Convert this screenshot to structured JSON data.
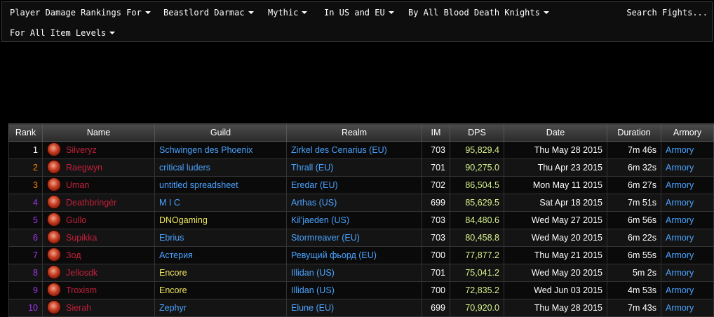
{
  "filters": {
    "rankings": "Player Damage Rankings For",
    "boss": "Beastlord Darmac",
    "difficulty": "Mythic",
    "region": "In US and EU",
    "class": "By All Blood Death Knights",
    "search": "Search Fights...",
    "item_levels": "For All Item Levels"
  },
  "table": {
    "headers": [
      "Rank",
      "Name",
      "Guild",
      "Realm",
      "IM",
      "DPS",
      "Date",
      "Duration",
      "Armory"
    ],
    "rows": [
      {
        "rank": "1",
        "rank_color": "#ffffff",
        "name": "Silveryz",
        "guild": "Schwingen des Phoenix",
        "guild_color": "#4aa3ff",
        "realm": "Zirkel des Cenarius (EU)",
        "im": "703",
        "dps": "95,829.4",
        "date": "Thu May 28 2015",
        "duration": "7m 46s",
        "armory": "Armory"
      },
      {
        "rank": "2",
        "rank_color": "#ff8000",
        "name": "Raegwyn",
        "guild": "critical luders",
        "guild_color": "#4aa3ff",
        "realm": "Thrall (EU)",
        "im": "701",
        "dps": "90,275.0",
        "date": "Thu Apr 23 2015",
        "duration": "6m 32s",
        "armory": "Armory"
      },
      {
        "rank": "3",
        "rank_color": "#ff8000",
        "name": "Uman",
        "guild": "untitled spreadsheet",
        "guild_color": "#4aa3ff",
        "realm": "Eredar (EU)",
        "im": "702",
        "dps": "86,504.5",
        "date": "Mon May 11 2015",
        "duration": "6m 27s",
        "armory": "Armory"
      },
      {
        "rank": "4",
        "rank_color": "#a335ee",
        "name": "Deathbringér",
        "guild": "M I C",
        "guild_color": "#4aa3ff",
        "realm": "Arthas (US)",
        "im": "699",
        "dps": "85,629.5",
        "date": "Sat Apr 18 2015",
        "duration": "7m 51s",
        "armory": "Armory"
      },
      {
        "rank": "5",
        "rank_color": "#a335ee",
        "name": "Gullo",
        "guild": "DNOgaming",
        "guild_color": "#f0e65c",
        "realm": "Kil'jaeden (US)",
        "im": "703",
        "dps": "84,480.6",
        "date": "Wed May 27 2015",
        "duration": "6m 56s",
        "armory": "Armory"
      },
      {
        "rank": "6",
        "rank_color": "#a335ee",
        "name": "Supikka",
        "guild": "Ebrius",
        "guild_color": "#4aa3ff",
        "realm": "Stormreaver (EU)",
        "im": "703",
        "dps": "80,458.8",
        "date": "Wed May 20 2015",
        "duration": "6m 22s",
        "armory": "Armory"
      },
      {
        "rank": "7",
        "rank_color": "#a335ee",
        "name": "Зод",
        "guild": "Астерия",
        "guild_color": "#4aa3ff",
        "realm": "Ревущий фьорд (EU)",
        "im": "700",
        "dps": "77,877.2",
        "date": "Thu May 21 2015",
        "duration": "6m 55s",
        "armory": "Armory"
      },
      {
        "rank": "8",
        "rank_color": "#a335ee",
        "name": "Jellosdk",
        "guild": "Encore",
        "guild_color": "#f0e65c",
        "realm": "Illidan (US)",
        "im": "701",
        "dps": "75,041.2",
        "date": "Wed May 20 2015",
        "duration": "5m 2s",
        "armory": "Armory"
      },
      {
        "rank": "9",
        "rank_color": "#a335ee",
        "name": "Troxism",
        "guild": "Encore",
        "guild_color": "#f0e65c",
        "realm": "Illidan (US)",
        "im": "700",
        "dps": "72,835.2",
        "date": "Wed Jun 03 2015",
        "duration": "4m 53s",
        "armory": "Armory"
      },
      {
        "rank": "10",
        "rank_color": "#a335ee",
        "name": "Sierah",
        "guild": "Zephyr",
        "guild_color": "#4aa3ff",
        "realm": "Elune (EU)",
        "im": "699",
        "dps": "70,920.0",
        "date": "Thu May 28 2015",
        "duration": "7m 43s",
        "armory": "Armory"
      }
    ]
  }
}
